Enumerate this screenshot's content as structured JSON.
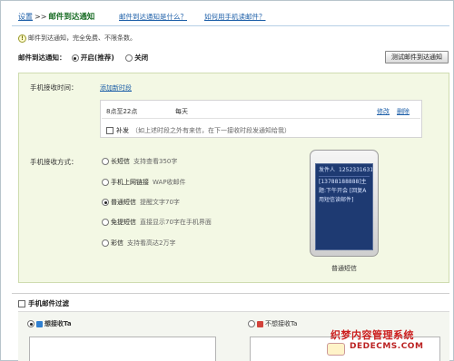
{
  "header": {
    "breadcrumb_home": "设置",
    "breadcrumb_sep": ">>",
    "breadcrumb_current": "邮件到达通知",
    "link_what": "邮件到达通知是什么？",
    "link_how": "如何用手机读邮件？"
  },
  "info": {
    "icon": "info-icon",
    "text": "邮件到达通知，完全免费、不限条数。"
  },
  "notify": {
    "label": "邮件到达通知：",
    "on_label": "开启(推荐)",
    "off_label": "关闭",
    "selected": "on",
    "test_button": "测试邮件到达通知"
  },
  "receive_time": {
    "label": "手机接收时间：",
    "add_link": "添加新时段",
    "slot": {
      "time": "8点至22点",
      "repeat": "每天",
      "edit": "修改",
      "delete": "删除"
    },
    "resend_label": "补发",
    "resend_desc": "（如上述时段之外有来信，在下一接收时段发通知给我）"
  },
  "receive_method": {
    "label": "手机接收方式：",
    "options": [
      {
        "name": "长短信",
        "desc": "支持查看350字",
        "selected": false
      },
      {
        "name": "手机上网链接",
        "desc": "WAP收邮件",
        "selected": false
      },
      {
        "name": "普通短信",
        "desc": "提醒文字70字",
        "selected": true
      },
      {
        "name": "免提短信",
        "desc": "直接显示70字在手机界面",
        "selected": false
      },
      {
        "name": "彩信",
        "desc": "支持看高达2万字",
        "selected": false
      }
    ]
  },
  "phone": {
    "sender_label": "发件人",
    "sender_number": "12523316316",
    "body": "[13788188888]主题:下午开会 [回复A用短信读邮件]",
    "caption": "普通短信"
  },
  "filter": {
    "label": "手机邮件过滤",
    "want": "想接收Ta",
    "not_want": "不想接收Ta"
  },
  "watermark": {
    "cn": "织梦内容管理系统",
    "en": "DEDECMS.COM"
  }
}
